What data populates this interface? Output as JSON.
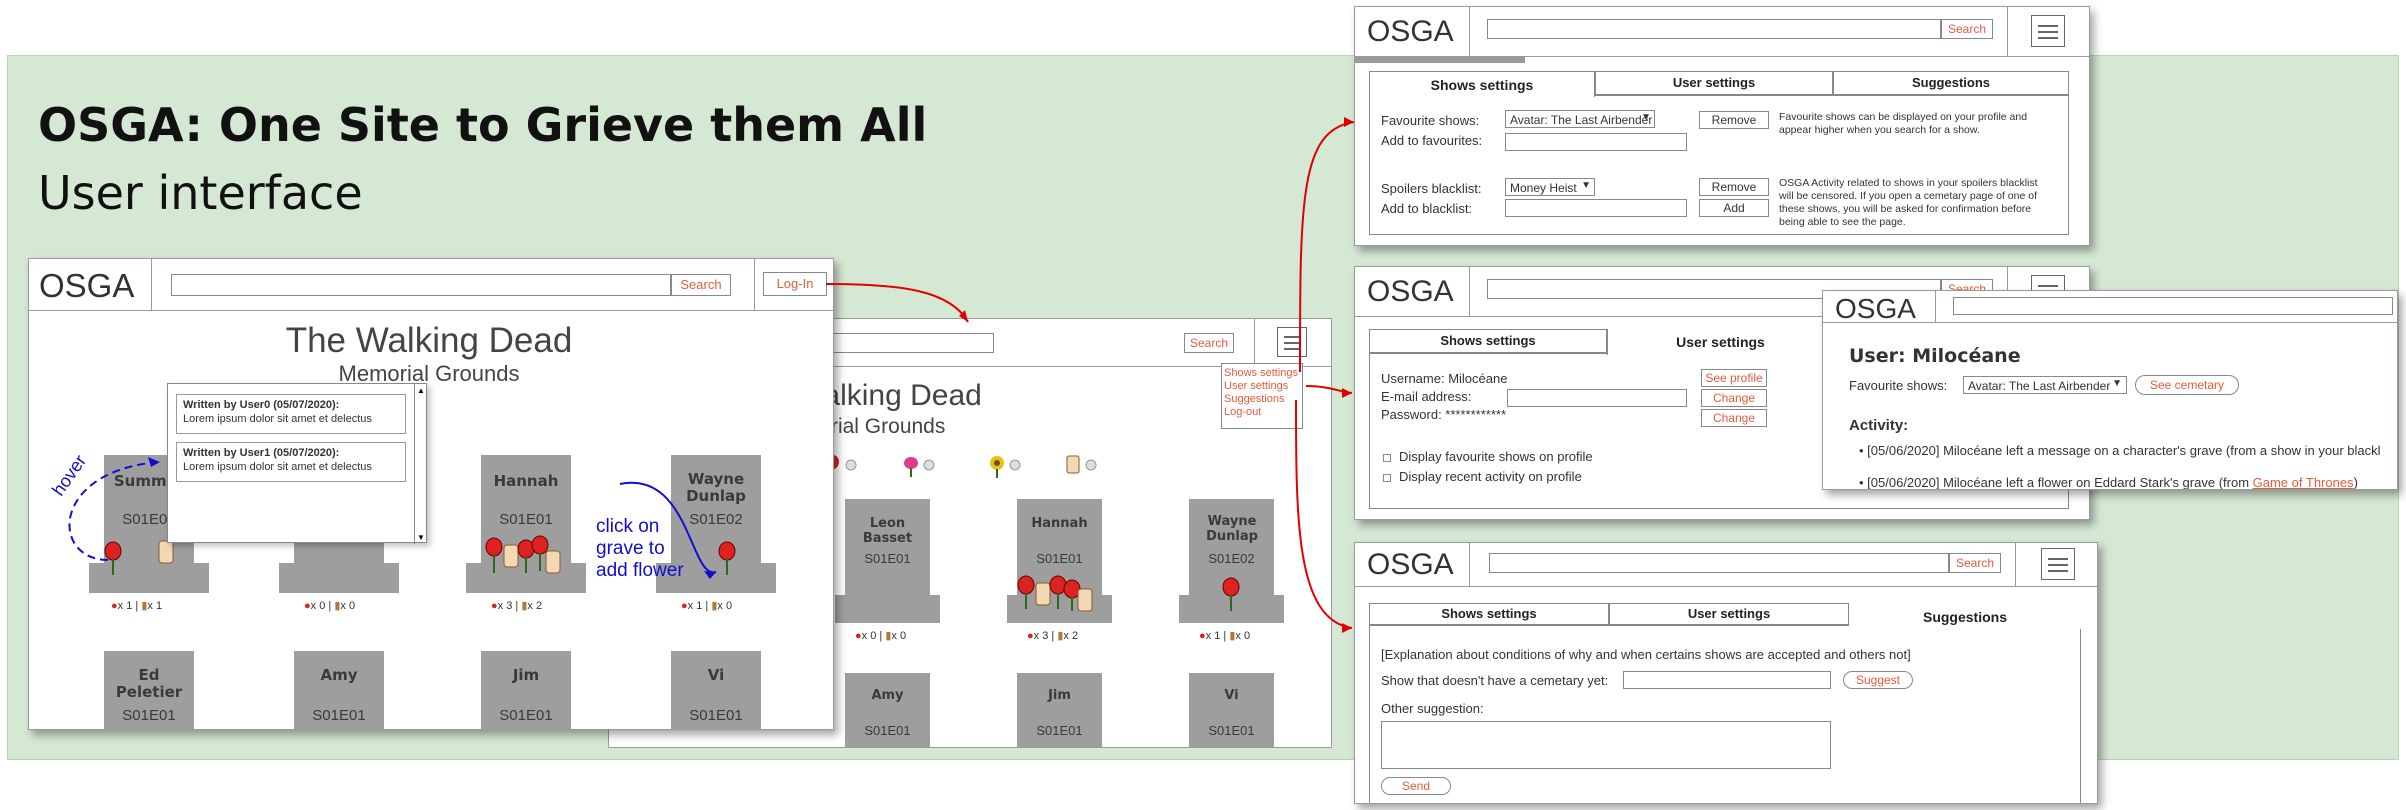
{
  "page": {
    "title": "OSGA: One Site to Grieve them All",
    "subtitle": "User interface"
  },
  "header": {
    "logo": "OSGA",
    "search_label": "Search",
    "login_label": "Log-In"
  },
  "memorial": {
    "title": "The Walking Dead",
    "subtitle": "Memorial Grounds",
    "graves_main": [
      {
        "name": "Summer",
        "ep": "S01E01",
        "flowers": "x 1",
        "messages": "x 1"
      },
      {
        "name": "",
        "ep": "",
        "flowers": "x 0",
        "messages": "x 0"
      },
      {
        "name": "Hannah",
        "ep": "S01E01",
        "flowers": "x 3",
        "messages": "x 2"
      },
      {
        "name": "Wayne Dunlap",
        "ep": "S01E02",
        "flowers": "x 1",
        "messages": "x 0"
      }
    ],
    "graves_main_row2": [
      {
        "name": "Ed Peletier",
        "ep": "S01E01"
      },
      {
        "name": "Amy",
        "ep": "S01E01"
      },
      {
        "name": "Jim",
        "ep": "S01E01"
      },
      {
        "name": "Vi",
        "ep": "S01E01"
      }
    ],
    "graves_second": [
      {
        "name": "Leon Basset",
        "ep": "S01E01",
        "flowers": "x 0",
        "messages": "x 0"
      },
      {
        "name": "Hannah",
        "ep": "S01E01",
        "flowers": "x 3",
        "messages": "x 2"
      },
      {
        "name": "Wayne Dunlap",
        "ep": "S01E02",
        "flowers": "x 1",
        "messages": "x 0"
      }
    ],
    "graves_second_row2": [
      {
        "name": "Amy",
        "ep": "S01E01"
      },
      {
        "name": "Jim",
        "ep": "S01E01"
      },
      {
        "name": "Vi",
        "ep": "S01E01"
      }
    ],
    "partial_ep": "S01E01"
  },
  "popup_messages": [
    {
      "author": "Written by User0  (05/07/2020):",
      "text": "Lorem ipsum dolor sit amet et delectus"
    },
    {
      "author": "Written by User1 (05/07/2020):",
      "text": "Lorem ipsum dolor sit amet et delectus"
    }
  ],
  "annotations": {
    "hover": "hover",
    "click_grave": "click on grave to add flower"
  },
  "menu": {
    "items": [
      "Shows settings",
      "User settings",
      "Suggestions",
      "Log-out"
    ]
  },
  "tabs": {
    "shows": "Shows settings",
    "user": "User settings",
    "suggestions": "Suggestions"
  },
  "shows_settings": {
    "fav_label": "Favourite shows:",
    "fav_value": "Avatar: The Last Airbender",
    "add_fav_label": "Add to favourites:",
    "remove_label": "Remove",
    "fav_hint": "Favourite shows can be displayed on your profile and appear higher when you search for a show.",
    "spoil_label": "Spoilers blacklist:",
    "spoil_value": "Money Heist",
    "add_black_label": "Add to blacklist:",
    "remove2_label": "Remove",
    "add_label": "Add",
    "spoil_hint": "OSGA Activity related to shows in your spoilers blacklist will be censored. If you open a cemetary page of one of these shows, you will be asked for confirmation before being able to see the page."
  },
  "user_settings": {
    "username_label": "Username: Milocéane",
    "see_profile": "See profile",
    "email_label": "E-mail address:",
    "change_label": "Change",
    "password_label": "Password: ************",
    "change2_label": "Change",
    "opt1": "Display favourite shows on profile",
    "opt2": "Display recent activity on profile"
  },
  "profile": {
    "user_title": "User: Milocéane",
    "fav_label": "Favourite shows:",
    "fav_value": "Avatar: The Last Airbender",
    "see_cemetary": "See cemetary",
    "activity_label": "Activity:",
    "activity": [
      {
        "text": "[05/06/2020] Milocéane left a message on a character's grave (from a show in your blackl"
      },
      {
        "text": "[05/06/2020] Milocéane left a flower on Eddard Stark's grave (from ",
        "link": "Game of Thrones",
        "after": ")"
      }
    ]
  },
  "suggestions": {
    "explanation": "[Explanation about conditions of why and when certains shows are accepted and others not]",
    "show_label": "Show that doesn't have a cemetary yet:",
    "suggest_btn": "Suggest",
    "other_label": "Other suggestion:",
    "send_btn": "Send"
  },
  "colors": {
    "accent": "#e85a3c",
    "background_green": "#d5e8d4",
    "grave_gray": "#9e9e9e",
    "arrow_red": "#e00000",
    "annotation_blue": "#1010cc"
  }
}
